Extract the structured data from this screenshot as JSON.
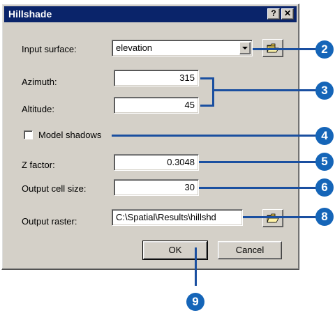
{
  "dialog": {
    "title": "Hillshade",
    "help_label": "?",
    "close_label": "✕"
  },
  "fields": {
    "input_surface": {
      "label": "Input surface:",
      "value": "elevation"
    },
    "azimuth": {
      "label": "Azimuth:",
      "value": "315"
    },
    "altitude": {
      "label": "Altitude:",
      "value": "45"
    },
    "model_shadows": {
      "label": "Model shadows",
      "checked": false
    },
    "z_factor": {
      "label": "Z factor:",
      "value": "0.3048"
    },
    "output_cell_size": {
      "label": "Output cell size:",
      "value": "30"
    },
    "output_raster": {
      "label": "Output raster:",
      "value": "C:\\Spatial\\Results\\hillshd"
    }
  },
  "buttons": {
    "ok": "OK",
    "cancel": "Cancel"
  },
  "callouts": {
    "c2": "2",
    "c3": "3",
    "c4": "4",
    "c5": "5",
    "c6": "6",
    "c8": "8",
    "c9": "9"
  },
  "icons": {
    "browse": "open-folder-icon",
    "dropdown": "chevron-down-icon"
  },
  "colors": {
    "titlebar": "#0a246a",
    "dialog_face": "#d4d0c8",
    "callout": "#1565b8"
  }
}
